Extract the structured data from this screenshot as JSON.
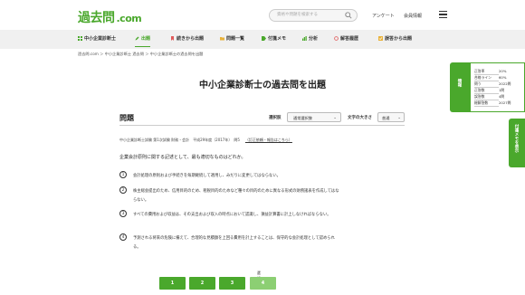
{
  "header": {
    "logo_main": "過去問",
    "logo_suffix": ".com",
    "search_placeholder": "資格や問題を検索する",
    "link_anchor": "アンケート",
    "link_member": "会員情報"
  },
  "nav": {
    "items": [
      {
        "label": "中小企業診断士"
      },
      {
        "label": "出題"
      },
      {
        "label": "続きから出題"
      },
      {
        "label": "問題一覧"
      },
      {
        "label": "付箋メモ"
      },
      {
        "label": "分析"
      },
      {
        "label": "解答履歴"
      },
      {
        "label": "誤答から出題"
      }
    ]
  },
  "breadcrumb": "過去問.com ＞ 中小企業診断士 過去問 ＞ 中小企業診断士の過去問を出題",
  "page_title": "中小企業診断士の過去問を出題",
  "question_bar": {
    "label": "問題",
    "mode_label": "選択肢",
    "mode_value": "通常選択肢",
    "font_label": "文字の大きさ",
    "font_value": "普通"
  },
  "meta": {
    "text": "中小企業診断士試験 第1次試験 財務・会計　平成29年度（2017年）　問5",
    "link": "（訂正依頼・報告はこちら）"
  },
  "question": "企業会計原則に関する記述として、最も適切なものはどれか。",
  "choices": [
    {
      "num": "1",
      "text": "会計処理の原則および手続きを毎期継続して適用し、みだりに変更してはならない。"
    },
    {
      "num": "2",
      "text": "株主総会提出のため、信用目的のため、租税目的のためなど種々の目的のために異なる形式の財務諸表を作成してはならない。"
    },
    {
      "num": "3",
      "text": "すべての費用および収益は、その支出および収入の時点において認識し、損益計算書に計上しなければならない。"
    },
    {
      "num": "4",
      "text": "予測される将来の危険に備えて、合理的な見積額を上回る費用を計上することは、保守的な会計処理として認められる。"
    }
  ],
  "pagination": {
    "pages": [
      "1",
      "2",
      "3",
      "4"
    ],
    "current_tag": "選択中"
  },
  "info_panel": {
    "tab_label": "情報",
    "rows": [
      {
        "k": "正答率",
        "v": "20%"
      },
      {
        "k": "合格ライン",
        "v": "60%"
      },
      {
        "k": "問う",
        "v": "2022問"
      },
      {
        "k": "正答数",
        "v": "1問"
      },
      {
        "k": "誤答数",
        "v": "4問"
      },
      {
        "k": "総解答数",
        "v": "2027問"
      }
    ]
  },
  "memo_tab": "付箋メモを表示",
  "colors": {
    "accent": "#4aa82c",
    "accent_light": "#8ccf73"
  }
}
